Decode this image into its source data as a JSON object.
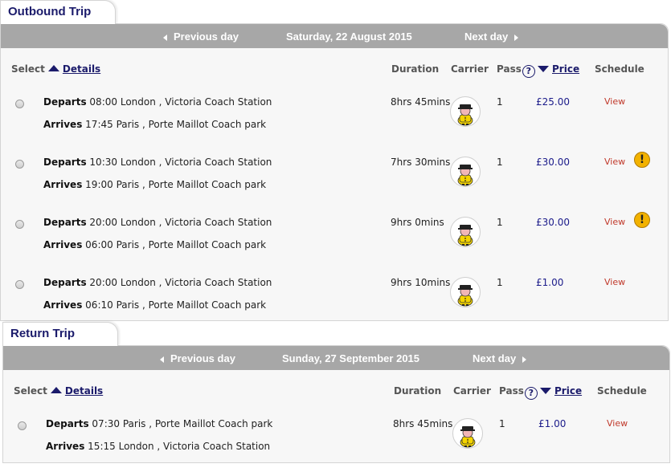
{
  "outbound": {
    "tab_title": "Outbound Trip",
    "prev_label": "Previous day",
    "date_label": "Saturday, 22 August 2015",
    "next_label": "Next day",
    "headers": {
      "select": "Select",
      "details": "Details",
      "duration": "Duration",
      "carrier": "Carrier",
      "pass": "Pass",
      "help": "?",
      "price": "Price",
      "schedule": "Schedule"
    },
    "rows": [
      {
        "departs_label": "Departs",
        "depart_time": "08:00",
        "depart_city": "London",
        "depart_station": "Victoria Coach Station",
        "arrives_label": "Arrives",
        "arrive_time": "17:45",
        "arrive_city": "Paris",
        "arrive_station": "Porte Maillot Coach park",
        "duration": "8hrs 45mins",
        "pass": "1",
        "price": "£25.00",
        "view": "View",
        "warning": ""
      },
      {
        "departs_label": "Departs",
        "depart_time": "10:30",
        "depart_city": "London",
        "depart_station": "Victoria Coach Station",
        "arrives_label": "Arrives",
        "arrive_time": "19:00",
        "arrive_city": "Paris",
        "arrive_station": "Porte Maillot Coach park",
        "duration": "7hrs 30mins",
        "pass": "1",
        "price": "£30.00",
        "view": "View",
        "warning": "!"
      },
      {
        "departs_label": "Departs",
        "depart_time": "20:00",
        "depart_city": "London",
        "depart_station": "Victoria Coach Station",
        "arrives_label": "Arrives",
        "arrive_time": "06:00",
        "arrive_city": "Paris",
        "arrive_station": "Porte Maillot Coach park",
        "duration": "9hrs 0mins",
        "pass": "1",
        "price": "£30.00",
        "view": "View",
        "warning": "!"
      },
      {
        "departs_label": "Departs",
        "depart_time": "20:00",
        "depart_city": "London",
        "depart_station": "Victoria Coach Station",
        "arrives_label": "Arrives",
        "arrive_time": "06:10",
        "arrive_city": "Paris",
        "arrive_station": "Porte Maillot Coach park",
        "duration": "9hrs 10mins",
        "pass": "1",
        "price": "£1.00",
        "view": "View",
        "warning": ""
      }
    ]
  },
  "return": {
    "tab_title": "Return Trip",
    "prev_label": "Previous day",
    "date_label": "Sunday, 27 September 2015",
    "next_label": "Next day",
    "headers": {
      "select": "Select",
      "details": "Details",
      "duration": "Duration",
      "carrier": "Carrier",
      "pass": "Pass",
      "help": "?",
      "price": "Price",
      "schedule": "Schedule"
    },
    "rows": [
      {
        "departs_label": "Departs",
        "depart_time": "07:30",
        "depart_city": "Paris",
        "depart_station": "Porte Maillot Coach park",
        "arrives_label": "Arrives",
        "arrive_time": "15:15",
        "arrive_city": "London",
        "arrive_station": "Victoria Coach Station",
        "duration": "8hrs 45mins",
        "pass": "1",
        "price": "£1.00",
        "view": "View",
        "warning": ""
      }
    ]
  },
  "colors": {
    "accent": "#1b1b6b",
    "nav_bar": "#a7a7a7",
    "view_link": "#c0392b",
    "warning": "#f2b200"
  },
  "icons": {
    "carrier": "coach-mascot-icon",
    "warning": "exclamation-icon",
    "help": "question-circle-icon"
  }
}
